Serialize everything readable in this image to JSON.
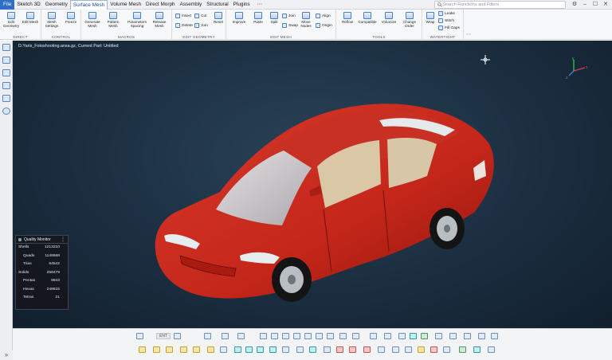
{
  "menubar": {
    "tabs": [
      {
        "label": "File",
        "state": "file"
      },
      {
        "label": "Sketch 3D",
        "state": ""
      },
      {
        "label": "Geometry",
        "state": ""
      },
      {
        "label": "Surface Mesh",
        "state": "active"
      },
      {
        "label": "Volume Mesh",
        "state": ""
      },
      {
        "label": "Direct Morph",
        "state": ""
      },
      {
        "label": "Assembly",
        "state": ""
      },
      {
        "label": "Structural",
        "state": ""
      },
      {
        "label": "Plugins",
        "state": ""
      }
    ],
    "more": "⋯",
    "search_placeholder": "Search Functions and Filters",
    "window_controls": [
      "⚙",
      "–",
      "☐",
      "✕"
    ]
  },
  "ribbon": {
    "direct": {
      "label": "DIRECT",
      "buttons": [
        "Edit Geometry",
        "Edit Mesh"
      ]
    },
    "control": {
      "label": "CONTROL",
      "buttons": [
        "Mesh Settings",
        "Freeze"
      ]
    },
    "macros": {
      "label": "MACROS",
      "buttons": [
        "Generate Mesh",
        "Pattern Mesh",
        "Parameters Spacing",
        "Release Mesh"
      ]
    },
    "edit_geometry": {
      "label": "EDIT GEOMETRY",
      "small": [
        "Insert",
        "Delete",
        "Cut",
        "Join"
      ],
      "buttons": [
        "Reset"
      ]
    },
    "edit_mesh": {
      "label": "EDIT MESH",
      "buttons": [
        "Improve",
        "Paste",
        "Split"
      ],
      "small": [
        "Join",
        "Swap"
      ],
      "big": "Move Nodes",
      "small2": [
        "Align",
        "Origin"
      ]
    },
    "tools": {
      "label": "TOOLS",
      "buttons": [
        "Reflow",
        "Compatible",
        "Volumize",
        "Change Order"
      ]
    },
    "watertight": {
      "label": "WATERTIGHT",
      "button": "Wrap",
      "small": [
        "Leaks",
        "Stitch",
        "Fill Gaps"
      ]
    }
  },
  "viewport": {
    "file_path": "D.Yaris_Fotoshooting.ansa.gz,  Current Part: Untitled",
    "car_body_color": "#c8281e",
    "background_color": "#1b2e40"
  },
  "quality_monitor": {
    "title": "Quality Monitor",
    "menu": "⋮",
    "rows": [
      {
        "label": "Shells",
        "value": "1213210",
        "indent": false
      },
      {
        "label": "Quads",
        "value": "1148668",
        "indent": true
      },
      {
        "label": "Trias",
        "value": "64542",
        "indent": true
      },
      {
        "label": "Solids",
        "value": "258479",
        "indent": false
      },
      {
        "label": "Pentas",
        "value": "9843",
        "indent": true
      },
      {
        "label": "Hexas",
        "value": "248615",
        "indent": true
      },
      {
        "label": "Tetras",
        "value": "21",
        "indent": true
      }
    ]
  },
  "bottom_toolbar": {
    "ent_label": "ENT"
  },
  "left_toolbar": {
    "expand": "»"
  },
  "colors": {
    "accent": "#2f6fc6",
    "car_red": "#c8281e",
    "viewport_dark": "#111f2c"
  }
}
